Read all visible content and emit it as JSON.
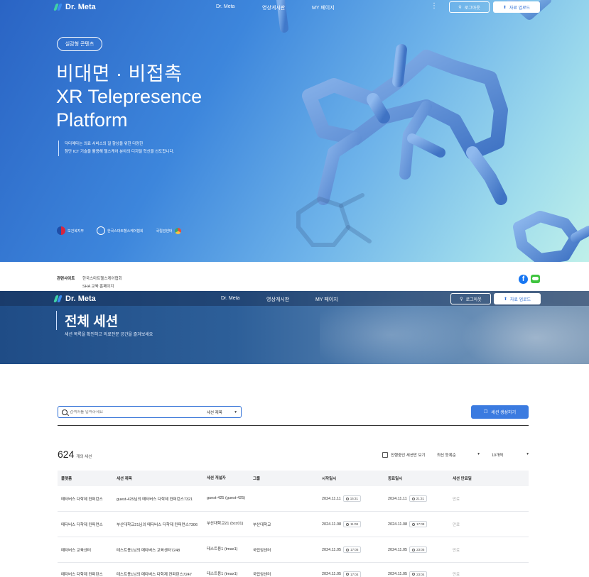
{
  "header": {
    "logo_text": "Dr. Meta",
    "nav": [
      "Dr. Meta",
      "영상게시판",
      "MY 페이지"
    ],
    "login_label": "로그아웃",
    "upload_label": "자료 업로드"
  },
  "hero": {
    "pill": "실감형 콘텐츠",
    "title_ko": "비대면 · 비접촉",
    "title_en": "XR Telepresence Platform",
    "desc_line1": "닥터메타는 의료 서비스의 질 향상을 위한 다양한",
    "desc_line2": "첨단 ICT 기술을 활용해 헬스케어 분야의 디지털 혁신을 선도합니다.",
    "partners": [
      "보건복지부",
      "한국스마트헬스케어협회",
      "국립암센터"
    ],
    "accent_color": "#3d86dc"
  },
  "footer": {
    "label": "관련사이트",
    "sites": [
      "한국스마트헬스케어협회",
      "SHA 교육 홈페이지"
    ]
  },
  "sessions_page": {
    "title": "전체 세션",
    "subtitle": "세션 목록을 확인하고 의료전문 공간을 즐겨보세요",
    "search": {
      "placeholder": "검색어를 입력하세요",
      "scope": "세션 제목"
    },
    "create_label": "세션 생성하기",
    "count": "624",
    "count_unit": "개의 세션",
    "ongoing_label": "진행중인 세션만 보기",
    "sort_label": "최신 등록순",
    "perpage_label": "10개씩",
    "columns": [
      "플랫폼",
      "세션 제목",
      "세션 개설자",
      "그룹",
      "시작일시",
      "종료일시",
      "세션 만료일"
    ],
    "rows": [
      {
        "platform": "메타버스 다학제 컨퍼런스",
        "title": "guest-425님의 메타버스 다학제 컨퍼런스7321",
        "owner": "guest-425 (guest-425)",
        "group": "",
        "start_date": "2024.11.11",
        "start_time": "15:31",
        "end_date": "2024.11.11",
        "end_time": "21:31",
        "status": "만료"
      },
      {
        "platform": "메타버스 다학제 컨퍼런스",
        "title": "부산대학교21님의 메타버스 다학제 컨퍼런스7306",
        "owner": "부산대학교21 (bcc01)",
        "group": "부산대학교",
        "start_date": "2024.11.08",
        "start_time": "11:08",
        "end_date": "2024.11.08",
        "end_time": "17:08",
        "status": "만료"
      },
      {
        "platform": "메타버스 교육센터",
        "title": "테스트용1님의 메타버스 교육센터7248",
        "owner": "테스트용1 (tmax1)",
        "group": "국립암센터",
        "start_date": "2024.11.05",
        "start_time": "17:05",
        "end_date": "2024.11.05",
        "end_time": "23:05",
        "status": "만료"
      },
      {
        "platform": "메타버스 다학제 컨퍼런스",
        "title": "테스트용1님의 메타버스 다학제 컨퍼런스7247",
        "owner": "테스트용1 (tmax1)",
        "group": "국립암센터",
        "start_date": "2024.11.05",
        "start_time": "17:04",
        "end_date": "2024.11.05",
        "end_time": "23:04",
        "status": "만료"
      }
    ]
  }
}
